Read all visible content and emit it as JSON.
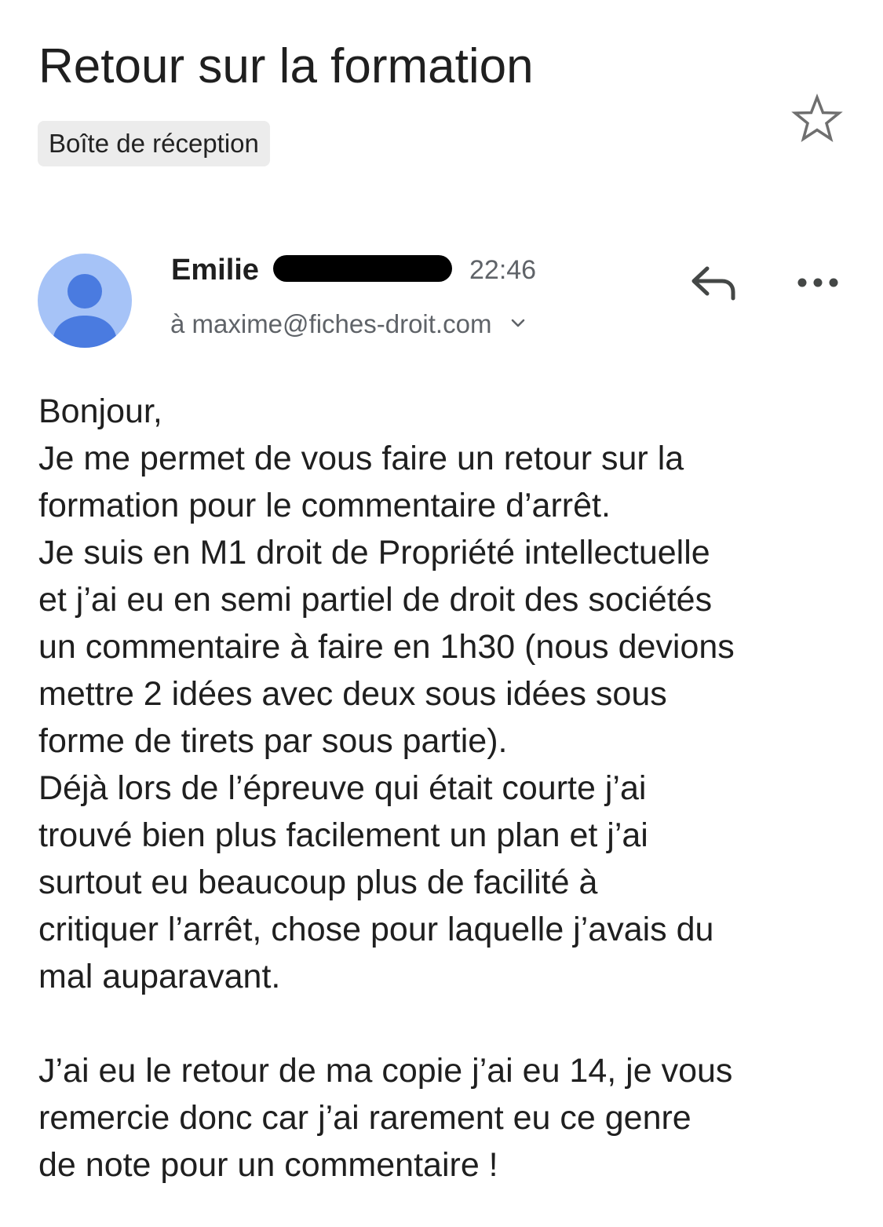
{
  "email": {
    "subject": "Retour sur la formation",
    "label": "Boîte de réception",
    "sender_first_name": "Emilie",
    "time": "22:46",
    "recipient": "à maxime@fiches-droit.com",
    "body_lines": [
      "Bonjour,",
      "Je me permet de vous faire un retour sur la",
      "formation pour le commentaire d’arrêt.",
      "Je suis en M1 droit de Propriété intellectuelle",
      "et j’ai eu en semi partiel de droit des sociétés",
      "un commentaire à faire en 1h30 (nous devions",
      "mettre 2 idées avec deux sous idées sous",
      "forme de tirets par sous partie).",
      "Déjà lors de l’épreuve qui était courte j’ai",
      "trouvé bien plus facilement un plan et j’ai",
      "surtout eu beaucoup plus de facilité à",
      "critiquer l’arrêt, chose pour laquelle j’avais du",
      "mal auparavant.",
      "",
      "J’ai eu le retour de ma copie j’ai eu 14, je vous",
      "remercie donc car j’ai rarement eu ce genre",
      "de note pour un commentaire !"
    ]
  },
  "icons": {
    "star": "star-outline-icon",
    "reply": "reply-arrow-icon",
    "more": "more-horizontal-icon",
    "chevron": "chevron-down-icon",
    "avatar": "person-avatar-icon"
  },
  "colors": {
    "avatar_bg": "#a6c3f7",
    "avatar_fg": "#4a7be0",
    "chip_bg": "#ececec",
    "secondary_text": "#5f6368",
    "redaction": "#000000"
  }
}
